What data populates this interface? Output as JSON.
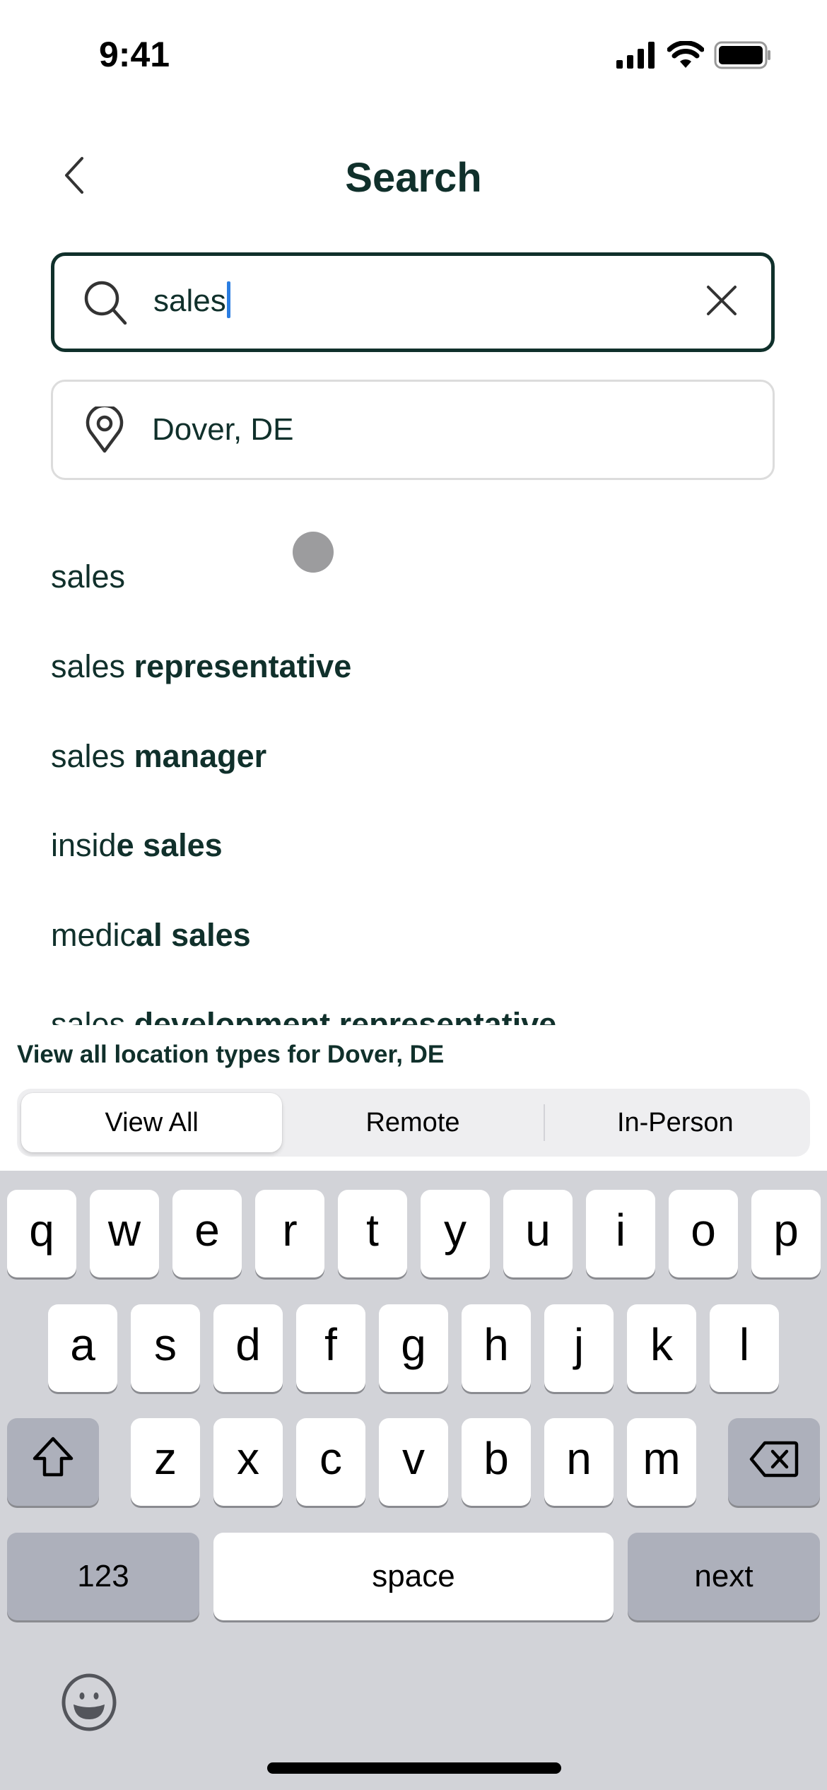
{
  "status_bar": {
    "time": "9:41",
    "icons": [
      "cellular-signal-icon",
      "wifi-icon",
      "battery-icon"
    ]
  },
  "header": {
    "back_icon": "chevron-left-icon",
    "title": "Search"
  },
  "search": {
    "icon": "search-icon",
    "value": "sales",
    "clear_icon": "close-icon"
  },
  "location": {
    "icon": "map-pin-icon",
    "value": "Dover, DE"
  },
  "suggestions": [
    {
      "plain": "sales",
      "bold": ""
    },
    {
      "plain": "sales ",
      "bold": "representative"
    },
    {
      "plain": "sales ",
      "bold": "manager"
    },
    {
      "plain": "insid",
      "bold": "e sales"
    },
    {
      "plain": "medic",
      "bold": "al sales"
    },
    {
      "plain": "sales ",
      "bold": "development representative"
    }
  ],
  "location_types": {
    "label": "View all location types for Dover, DE",
    "options": [
      "View All",
      "Remote",
      "In-Person"
    ],
    "selected": "View All"
  },
  "keyboard": {
    "row1": [
      "q",
      "w",
      "e",
      "r",
      "t",
      "y",
      "u",
      "i",
      "o",
      "p"
    ],
    "row2": [
      "a",
      "s",
      "d",
      "f",
      "g",
      "h",
      "j",
      "k",
      "l"
    ],
    "row3": [
      "z",
      "x",
      "c",
      "v",
      "b",
      "n",
      "m"
    ],
    "shift_icon": "shift-arrow-icon",
    "delete_icon": "backspace-icon",
    "numbers_label": "123",
    "space_label": "space",
    "return_label": "next",
    "emoji_icon": "emoji-smile-icon"
  },
  "colors": {
    "brand_text": "#10302b",
    "caret": "#2a7de1",
    "keyboard_bg": "#d2d3d8",
    "function_key": "#adb0bb"
  }
}
